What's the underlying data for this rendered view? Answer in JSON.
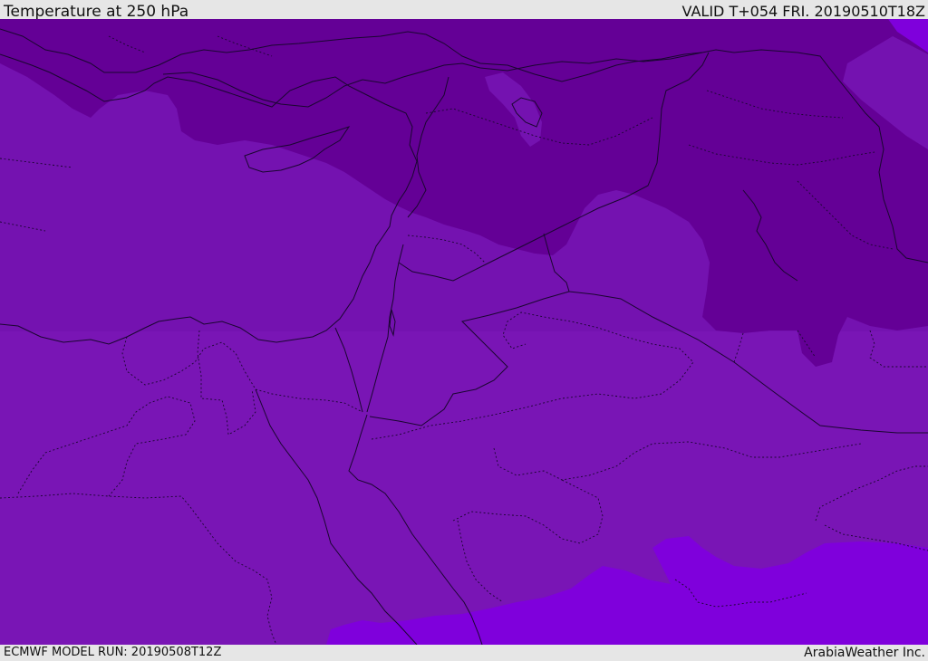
{
  "header": {
    "title": "Temperature at 250 hPa",
    "valid": "VALID T+054 FRI. 20190510T18Z"
  },
  "footer": {
    "model_run": "ECMWF MODEL RUN: 20190508T12Z",
    "credit": "ArabiaWeather Inc."
  },
  "map": {
    "variable": "temperature",
    "level": "250 hPa",
    "colors": {
      "coldest": "#640096",
      "cold": "#7412b0",
      "mid": "#7a14b6",
      "warm": "#7f00dc",
      "border": "#1a0630"
    }
  }
}
